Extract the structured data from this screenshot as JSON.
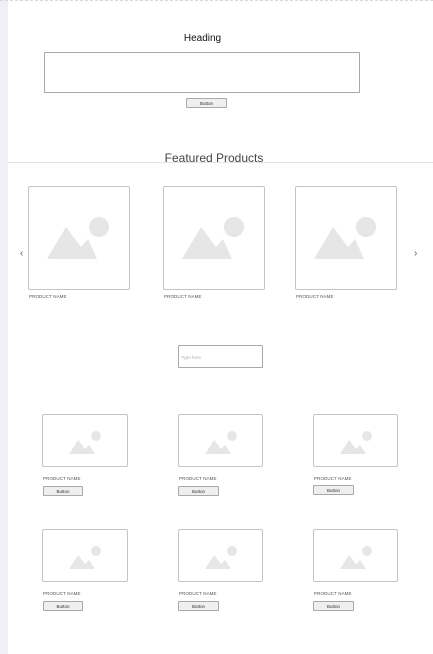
{
  "hero": {
    "heading": "Heading",
    "button_label": "Button"
  },
  "featured": {
    "title": "Featured Products",
    "prev_icon": "‹",
    "next_icon": "›",
    "products": [
      {
        "name": "PRODUCT NAME"
      },
      {
        "name": "PRODUCT NAME"
      },
      {
        "name": "PRODUCT NAME"
      }
    ]
  },
  "search": {
    "placeholder": "Type here"
  },
  "grid": {
    "products": [
      {
        "name": "PRODUCT NAME",
        "button_label": "Button"
      },
      {
        "name": "PRODUCT NAME",
        "button_label": "Button"
      },
      {
        "name": "PRODUCT NAME",
        "button_label": "Button"
      },
      {
        "name": "PRODUCT NAME",
        "button_label": "Button"
      },
      {
        "name": "PRODUCT NAME",
        "button_label": "Button"
      },
      {
        "name": "PRODUCT NAME",
        "button_label": "Button"
      }
    ]
  },
  "colors": {
    "placeholder_image": "#e6e6e6",
    "border": "#c4c4c4"
  },
  "icons": {
    "image_placeholder": "image-placeholder-icon"
  }
}
